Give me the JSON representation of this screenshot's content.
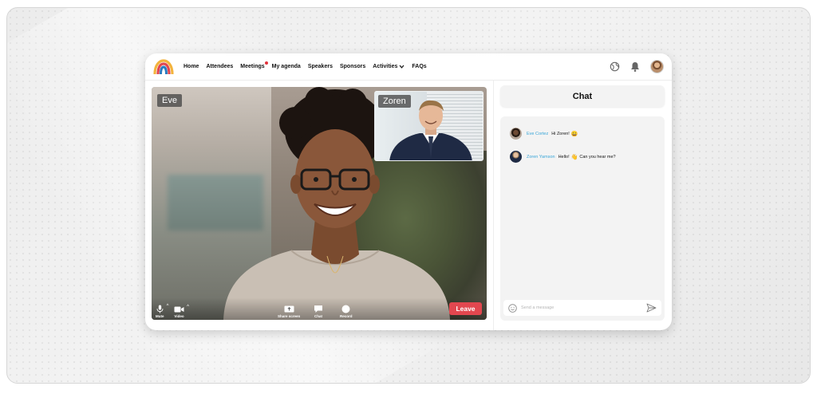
{
  "nav": {
    "items": [
      {
        "label": "Home",
        "has_dot": false,
        "has_caret": false
      },
      {
        "label": "Attendees",
        "has_dot": false,
        "has_caret": false
      },
      {
        "label": "Meetings",
        "has_dot": true,
        "has_caret": false
      },
      {
        "label": "My agenda",
        "has_dot": false,
        "has_caret": false
      },
      {
        "label": "Speakers",
        "has_dot": false,
        "has_caret": false
      },
      {
        "label": "Sponsors",
        "has_dot": false,
        "has_caret": false
      },
      {
        "label": "Activities",
        "has_dot": false,
        "has_caret": true
      },
      {
        "label": "FAQs",
        "has_dot": false,
        "has_caret": false
      }
    ],
    "icons": [
      "globe-icon",
      "bell-icon",
      "user-avatar"
    ]
  },
  "video": {
    "main_participant": "Eve",
    "pip_participant": "Zoren",
    "controls": {
      "mute": "Mute",
      "video": "Video",
      "share": "Share screen",
      "chat": "Chat",
      "record": "Record"
    },
    "leave_label": "Leave"
  },
  "chat": {
    "title": "Chat",
    "messages": [
      {
        "name": "Eve Cortez",
        "text": "Hi Zoren!",
        "emoji": "😀"
      },
      {
        "name": "Zoren Yamson",
        "text": "Hello!",
        "emoji": "👋",
        "text2": "Can you hear me?"
      }
    ],
    "input_placeholder": "Send a message"
  },
  "colors": {
    "accent_red": "#e2474f",
    "notification_dot": "#e2313b",
    "chat_name": "#3aa6d8"
  }
}
